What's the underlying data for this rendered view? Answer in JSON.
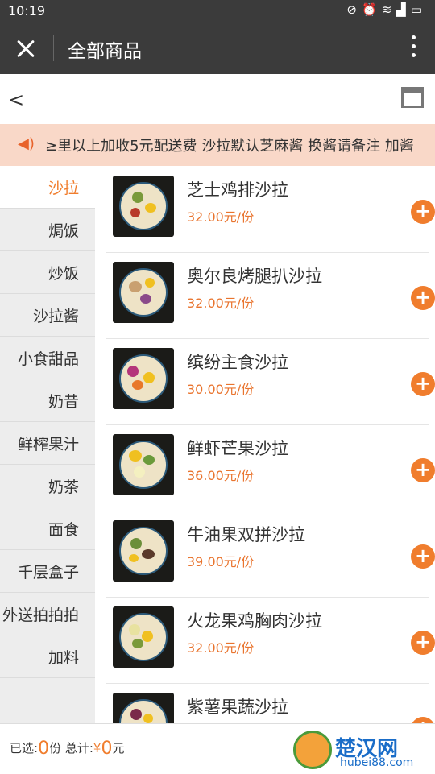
{
  "status": {
    "time": "10:19",
    "icons": [
      "mute-icon",
      "alarm-icon",
      "wifi-icon",
      "signal-icon",
      "battery-icon"
    ]
  },
  "header": {
    "title": "全部商品"
  },
  "notice": {
    "text": "≥里以上加收5元配送费 沙拉默认芝麻酱 换酱请备注 加酱"
  },
  "categories": [
    {
      "label": "沙拉",
      "active": true
    },
    {
      "label": "焗饭"
    },
    {
      "label": "炒饭"
    },
    {
      "label": "沙拉酱"
    },
    {
      "label": "小食甜品"
    },
    {
      "label": "奶昔"
    },
    {
      "label": "鲜榨果汁"
    },
    {
      "label": "奶茶"
    },
    {
      "label": "面食"
    },
    {
      "label": "千层盒子"
    },
    {
      "label": "外送拍拍拍"
    },
    {
      "label": "加料"
    }
  ],
  "products": [
    {
      "name": "芝士鸡排沙拉",
      "price": "32.00元/份"
    },
    {
      "name": "奥尔良烤腿扒沙拉",
      "price": "32.00元/份"
    },
    {
      "name": "缤纷主食沙拉",
      "price": "30.00元/份"
    },
    {
      "name": "鲜虾芒果沙拉",
      "price": "36.00元/份"
    },
    {
      "name": "牛油果双拼沙拉",
      "price": "39.00元/份"
    },
    {
      "name": "火龙果鸡胸肉沙拉",
      "price": "32.00元/份"
    },
    {
      "name": "紫薯果蔬沙拉",
      "price": ""
    }
  ],
  "cart": {
    "selected_label": "已选:",
    "count": "0",
    "count_unit": "份",
    "total_label": "总计:",
    "currency": "¥",
    "total": "0",
    "total_unit": "元"
  },
  "watermark": {
    "cn": "楚汉网",
    "en": "hubei88.com"
  },
  "colors": {
    "accent": "#f07d2d",
    "header": "#3b3b3b",
    "notice_bg": "#f9d8c8"
  }
}
